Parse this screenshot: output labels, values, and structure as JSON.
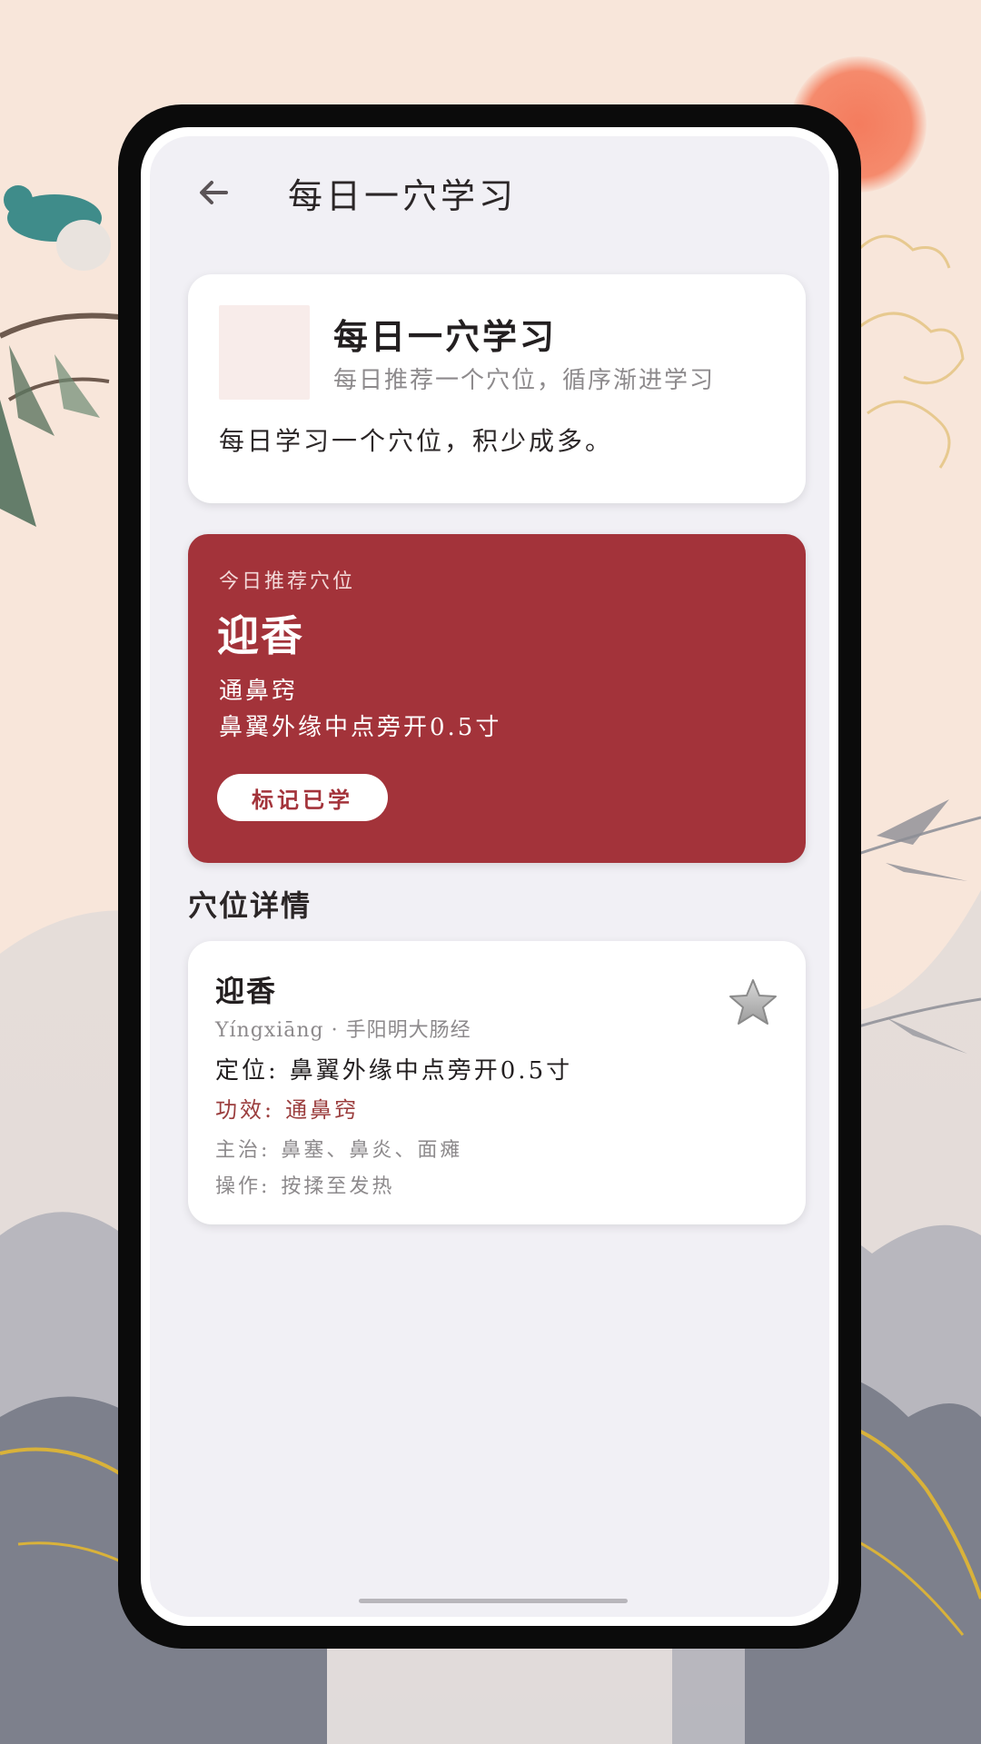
{
  "header": {
    "back_icon": "arrow-left-icon",
    "title": "每日一穴学习"
  },
  "intro": {
    "title": "每日一穴学习",
    "subtitle": "每日推荐一个穴位，循序渐进学习",
    "description": "每日学习一个穴位，积少成多。"
  },
  "recommend": {
    "label": "今日推荐穴位",
    "name": "迎香",
    "effect": "通鼻窍",
    "location": "鼻翼外缘中点旁开0.5寸",
    "mark_button": "标记已学",
    "accent_color": "#a3333a"
  },
  "detail": {
    "section_title": "穴位详情",
    "name": "迎香",
    "meta": "Yíngxiāng · 手阳明大肠经",
    "location_label": "定位:",
    "location": "鼻翼外缘中点旁开0.5寸",
    "effect_label": "功效:",
    "effect": "通鼻窍",
    "indication_label": "主治:",
    "indication": "鼻塞、鼻炎、面瘫",
    "operation_label": "操作:",
    "operation": "按揉至发热",
    "favorite_icon": "star-icon"
  }
}
